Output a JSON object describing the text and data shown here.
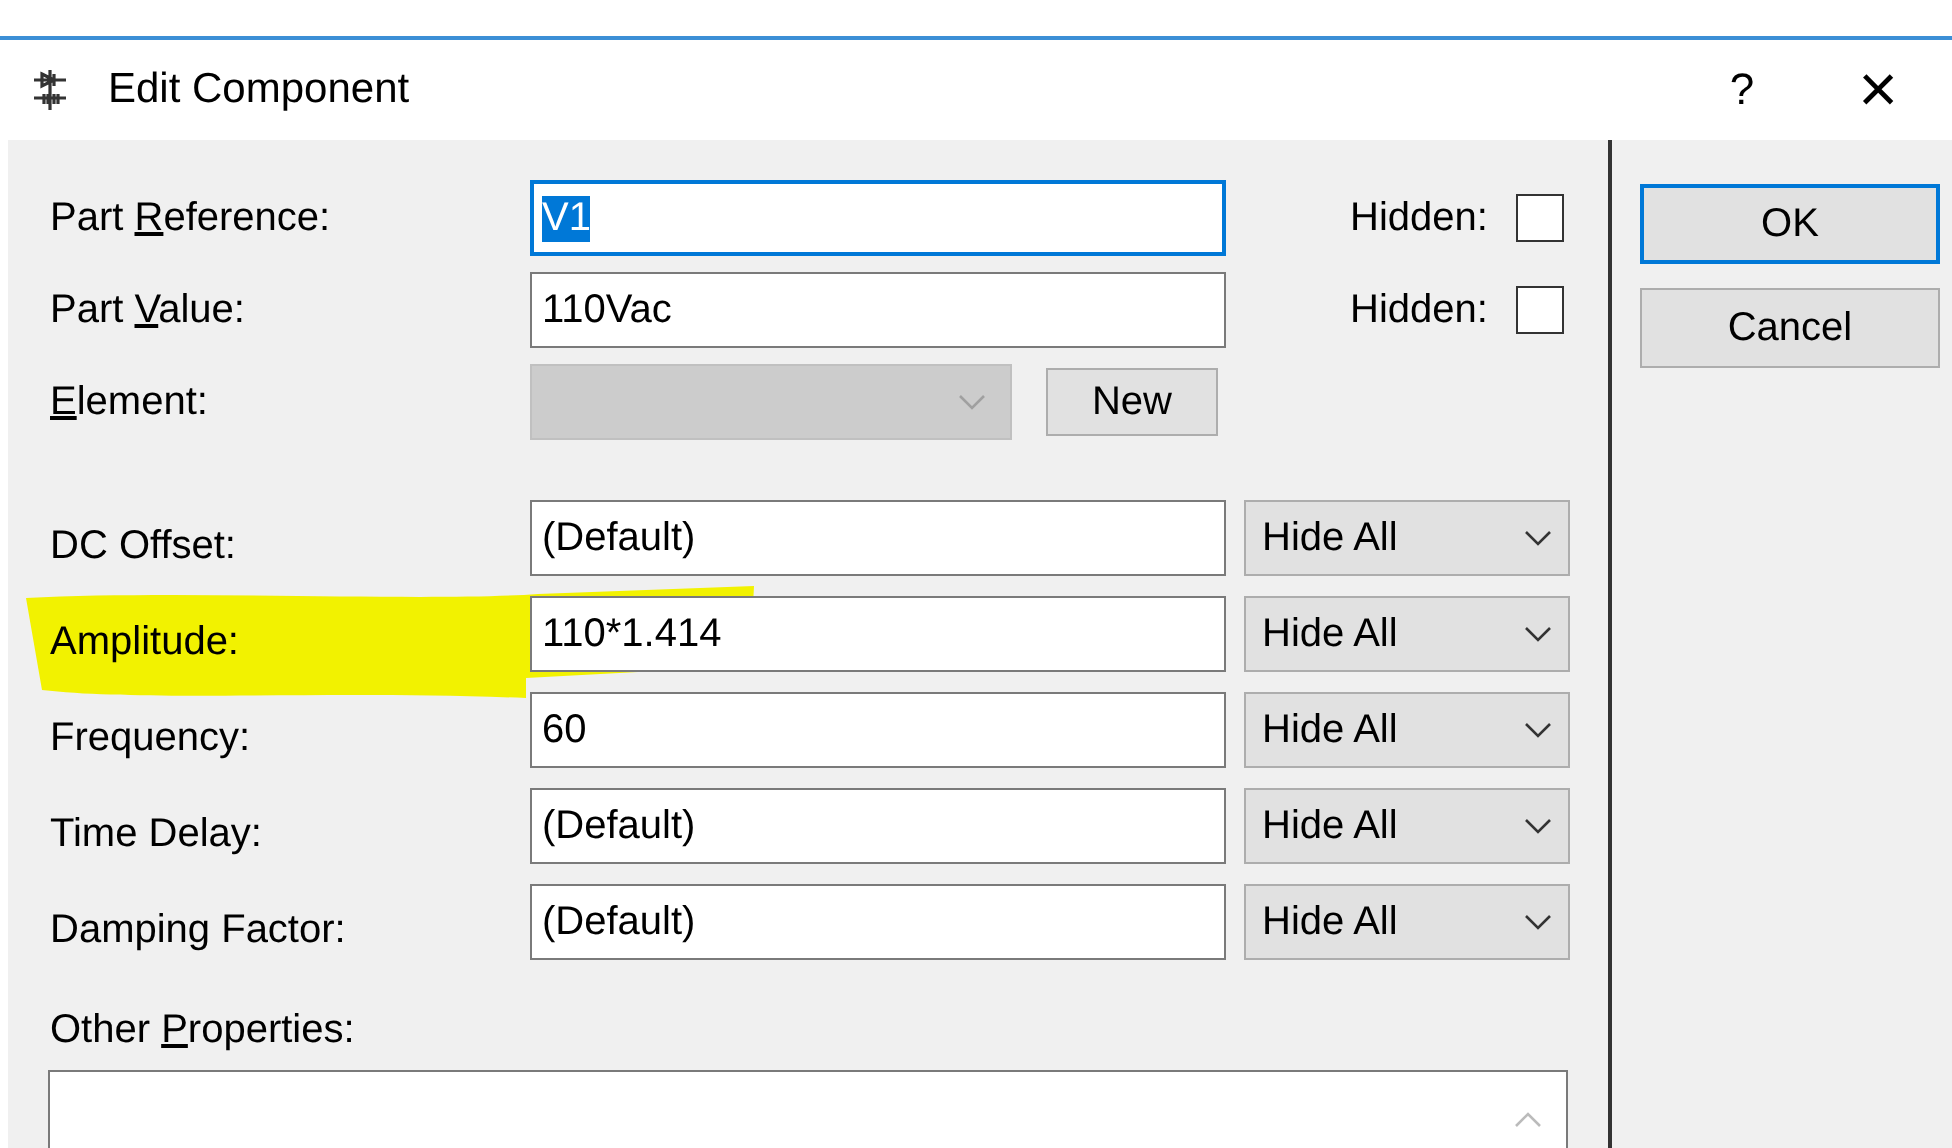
{
  "window": {
    "title": "Edit Component",
    "help": "?",
    "close": "×"
  },
  "top_fields": [
    {
      "kind": "text",
      "label": {
        "pre": "Part ",
        "key": "R",
        "post": "eference:"
      },
      "value": "V1",
      "focused": true,
      "hidden_label": "Hidden:",
      "hidden_checked": false
    },
    {
      "kind": "text",
      "label": {
        "pre": "Part ",
        "key": "V",
        "post": "alue:"
      },
      "value": "110Vac",
      "focused": false,
      "hidden_label": "Hidden:",
      "hidden_checked": false
    },
    {
      "kind": "combo",
      "label": {
        "key": "E",
        "post": "lement:"
      },
      "disabled": true,
      "button": "New"
    }
  ],
  "params": [
    {
      "label": "DC Offset:",
      "value": "(Default)",
      "visibility": "Hide All",
      "highlighted": false
    },
    {
      "label": "Amplitude:",
      "value": "110*1.414",
      "visibility": "Hide All",
      "highlighted": true
    },
    {
      "label": "Frequency:",
      "value": "60",
      "visibility": "Hide All",
      "highlighted": false
    },
    {
      "label": "Time Delay:",
      "value": "(Default)",
      "visibility": "Hide All",
      "highlighted": false
    },
    {
      "label": "Damping Factor:",
      "value": "(Default)",
      "visibility": "Hide All",
      "highlighted": false
    }
  ],
  "other_properties": {
    "label": {
      "pre": "Other ",
      "key": "P",
      "post": "roperties:"
    }
  },
  "buttons": [
    {
      "label": "OK",
      "default": true
    },
    {
      "label": "Cancel",
      "default": false
    }
  ]
}
